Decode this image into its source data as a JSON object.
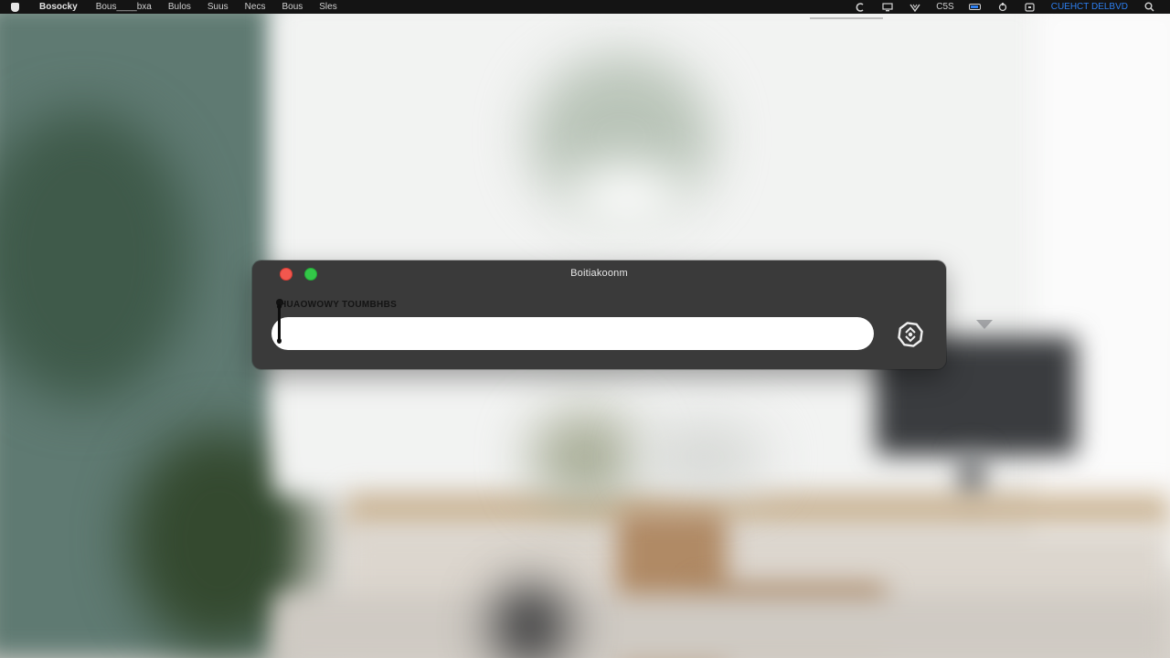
{
  "menubar": {
    "app_name": "Bosocky",
    "items": [
      "Bous____bxa",
      "Bulos",
      "Suus",
      "Necs",
      "Bous",
      "Sles"
    ],
    "status": {
      "time_code": "C5S",
      "clock_text": "CUEHCT DELBVD"
    },
    "colors": {
      "accent": "#2d7ff0",
      "bar": "#141414"
    }
  },
  "dialog": {
    "title": "Boitiakoonm",
    "field_label": "HUAOWOWY TOUMBHBS",
    "search_value": "",
    "traffic_colors": {
      "close": "#f2574e",
      "zoom": "#33c748"
    },
    "action_icon": "puzzle-link-icon"
  }
}
